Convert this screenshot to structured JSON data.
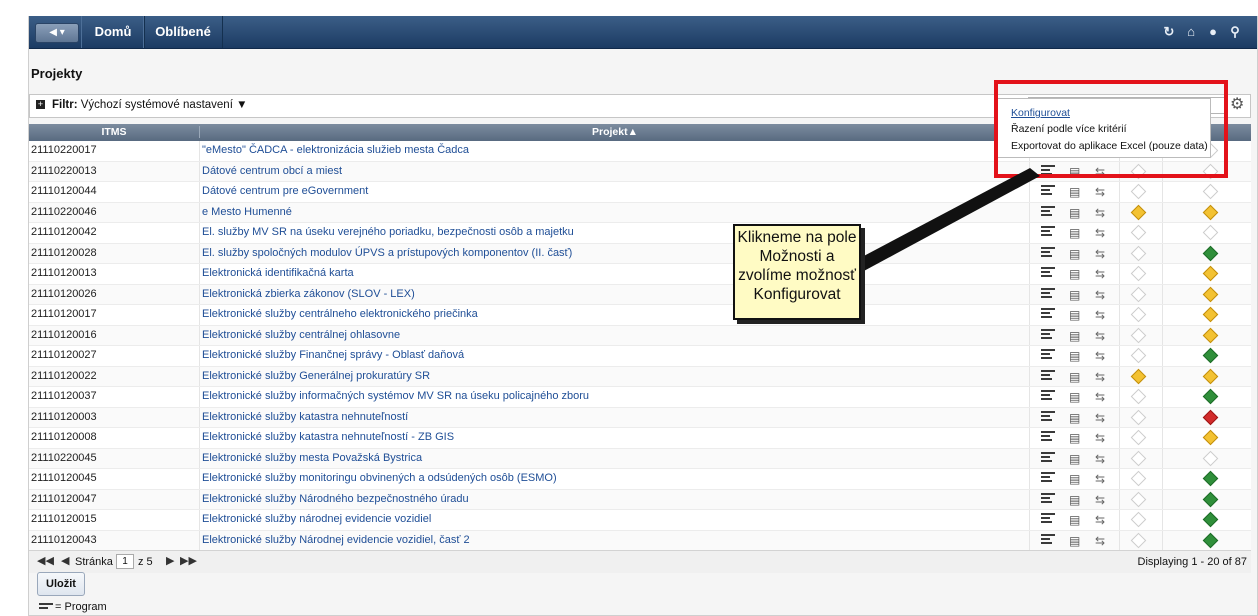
{
  "nav": {
    "back_label": "◀ ▾",
    "home_label": "Domů",
    "favorites_label": "Oblíbené",
    "icons": [
      "refresh-icon",
      "home-icon",
      "help-icon",
      "search-icon"
    ]
  },
  "page": {
    "title": "Projekty",
    "filter_prefix": "Filtr:",
    "filter_value": "Výchozí systémové nastavení ▼",
    "options_placeholder": ""
  },
  "options_menu": {
    "items": [
      "Konfigurovat",
      "Řazení podle více kritérií",
      "Exportovat do aplikace Excel (pouze data)"
    ]
  },
  "table": {
    "headers": [
      "ITMS",
      "Projekt▲"
    ],
    "rows": [
      {
        "itms": "21110220017",
        "project": "\"eMesto\" ČADCA - elektronizácia služieb mesta Čadca",
        "s1": "empty",
        "s2": "empty"
      },
      {
        "itms": "21110220013",
        "project": "Dátové centrum obcí a miest",
        "s1": "empty",
        "s2": "empty"
      },
      {
        "itms": "21110120044",
        "project": "Dátové centrum pre eGovernment",
        "s1": "empty",
        "s2": "empty"
      },
      {
        "itms": "21110220046",
        "project": "e Mesto Humenné",
        "s1": "yellow",
        "s2": "yellow"
      },
      {
        "itms": "21110120042",
        "project": "El. služby MV SR na úseku verejného poriadku, bezpečnosti osôb a majetku",
        "s1": "empty",
        "s2": "empty"
      },
      {
        "itms": "21110120028",
        "project": "El. služby spoločných modulov ÚPVS a prístupových komponentov (II. časť)",
        "s1": "empty",
        "s2": "green"
      },
      {
        "itms": "21110120013",
        "project": "Elektronická identifikačná karta",
        "s1": "empty",
        "s2": "yellow"
      },
      {
        "itms": "21110120026",
        "project": "Elektronická zbierka zákonov (SLOV - LEX)",
        "s1": "empty",
        "s2": "yellow"
      },
      {
        "itms": "21110120017",
        "project": "Elektronické služby centrálneho elektronického priečinka",
        "s1": "empty",
        "s2": "yellow"
      },
      {
        "itms": "21110120016",
        "project": "Elektronické služby centrálnej ohlasovne",
        "s1": "empty",
        "s2": "yellow"
      },
      {
        "itms": "21110120027",
        "project": "Elektronické služby Finančnej správy - Oblasť daňová",
        "s1": "empty",
        "s2": "green"
      },
      {
        "itms": "21110120022",
        "project": "Elektronické služby Generálnej prokuratúry SR",
        "s1": "yellow",
        "s2": "yellow"
      },
      {
        "itms": "21110120037",
        "project": "Elektronické služby informačných systémov MV SR na úseku policajného zboru",
        "s1": "empty",
        "s2": "green"
      },
      {
        "itms": "21110120003",
        "project": "Elektronické služby katastra nehnuteľností",
        "s1": "empty",
        "s2": "red"
      },
      {
        "itms": "21110120008",
        "project": "Elektronické služby katastra nehnuteľností - ZB GIS",
        "s1": "empty",
        "s2": "yellow"
      },
      {
        "itms": "21110220045",
        "project": "Elektronické služby mesta Považská Bystrica",
        "s1": "empty",
        "s2": "empty"
      },
      {
        "itms": "21110120045",
        "project": "Elektronické služby monitoringu obvinených a odsúdených osôb (ESMO)",
        "s1": "empty",
        "s2": "green"
      },
      {
        "itms": "21110120047",
        "project": "Elektronické služby Národného bezpečnostného úradu",
        "s1": "empty",
        "s2": "green"
      },
      {
        "itms": "21110120015",
        "project": "Elektronické služby národnej evidencie vozidiel",
        "s1": "empty",
        "s2": "green"
      },
      {
        "itms": "21110120043",
        "project": "Elektronické služby Národnej evidencie vozidiel, časť 2",
        "s1": "empty",
        "s2": "green"
      }
    ]
  },
  "pager": {
    "page_label": "Stránka",
    "current_page": "1",
    "of_label": "z 5",
    "displaying": "Displaying 1 - 20 of 87"
  },
  "actions": {
    "save_label": "Uložit"
  },
  "legend": {
    "program_label": "= Program"
  },
  "annotation": {
    "text": "Klikneme na pole Možnosti a zvolíme možnosť Konfigurovat"
  },
  "colors": {
    "highlight": "#e3121a",
    "link": "#1f4e96",
    "callout_bg": "#fffbc4",
    "status_yellow": "#f3c232",
    "status_green": "#2f8f3a",
    "status_red": "#d22b2b"
  }
}
